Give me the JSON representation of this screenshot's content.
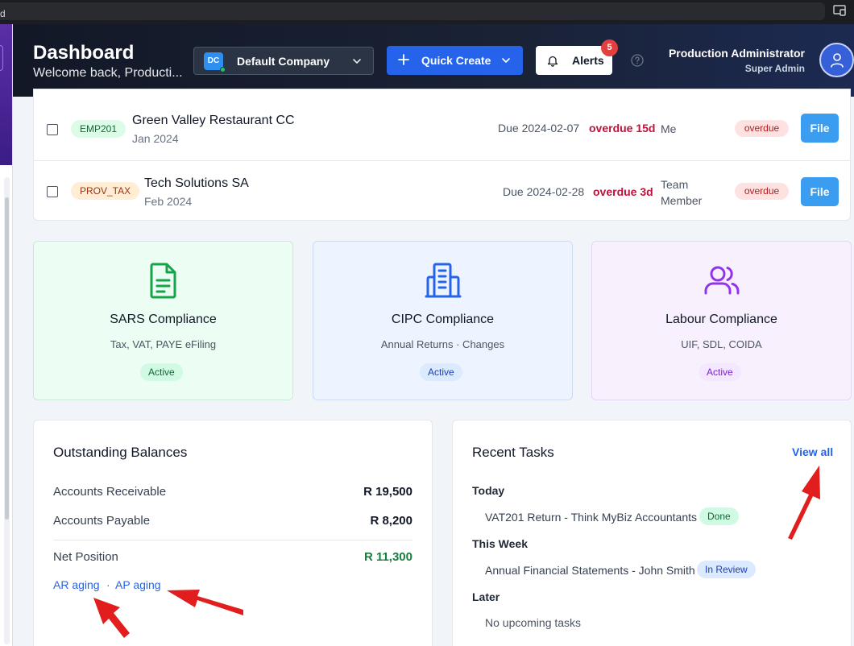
{
  "browser": {
    "address_text": "d"
  },
  "header": {
    "title": "Dashboard",
    "subtitle": "Welcome back, Producti...",
    "company": {
      "initials": "DC",
      "name": "Default Company"
    },
    "quick_create_label": "Quick Create",
    "alerts": {
      "label": "Alerts",
      "count": "5"
    },
    "user": {
      "name": "Production Administrator",
      "role": "Super Admin"
    }
  },
  "filings": [
    {
      "type": "EMP201",
      "client": "Green Valley Restaurant CC",
      "period": "Jan 2024",
      "due": "Due 2024-02-07",
      "overdue": "overdue 15d",
      "assignee": "Me",
      "status": "overdue",
      "action": "File"
    },
    {
      "type": "PROV_TAX",
      "client": "Tech Solutions SA",
      "period": "Feb 2024",
      "due": "Due 2024-02-28",
      "overdue": "overdue 3d",
      "assignee": "Team Member",
      "status": "overdue",
      "action": "File"
    }
  ],
  "compliance": [
    {
      "title": "SARS Compliance",
      "subtitle": "Tax, VAT, PAYE eFiling",
      "status": "Active",
      "icon": "document-icon",
      "color": "#16a34a"
    },
    {
      "title": "CIPC Compliance",
      "subtitle": "Annual Returns · Changes",
      "status": "Active",
      "icon": "building-icon",
      "color": "#2563eb"
    },
    {
      "title": "Labour Compliance",
      "subtitle": "UIF, SDL, COIDA",
      "status": "Active",
      "icon": "users-icon",
      "color": "#9333ea"
    }
  ],
  "balances": {
    "title": "Outstanding Balances",
    "rows": [
      {
        "label": "Accounts Receivable",
        "value": "R 19,500"
      },
      {
        "label": "Accounts Payable",
        "value": "R 8,200"
      }
    ],
    "net": {
      "label": "Net Position",
      "value": "R 11,300"
    },
    "links": {
      "ar": "AR aging",
      "separator": "·",
      "ap": "AP aging"
    }
  },
  "tasks": {
    "title": "Recent Tasks",
    "view_all": "View all",
    "groups": [
      {
        "label": "Today",
        "text": "VAT201 Return - Think MyBiz Accountants",
        "badge": "Done"
      },
      {
        "label": "This Week",
        "text": "Annual Financial Statements - John Smith",
        "badge": "In Review"
      },
      {
        "label": "Later",
        "text": "No upcoming tasks"
      }
    ]
  },
  "colors": {
    "accent": "#2563eb",
    "overdue": "#be123c",
    "annotation_arrow": "#e11d1d"
  }
}
